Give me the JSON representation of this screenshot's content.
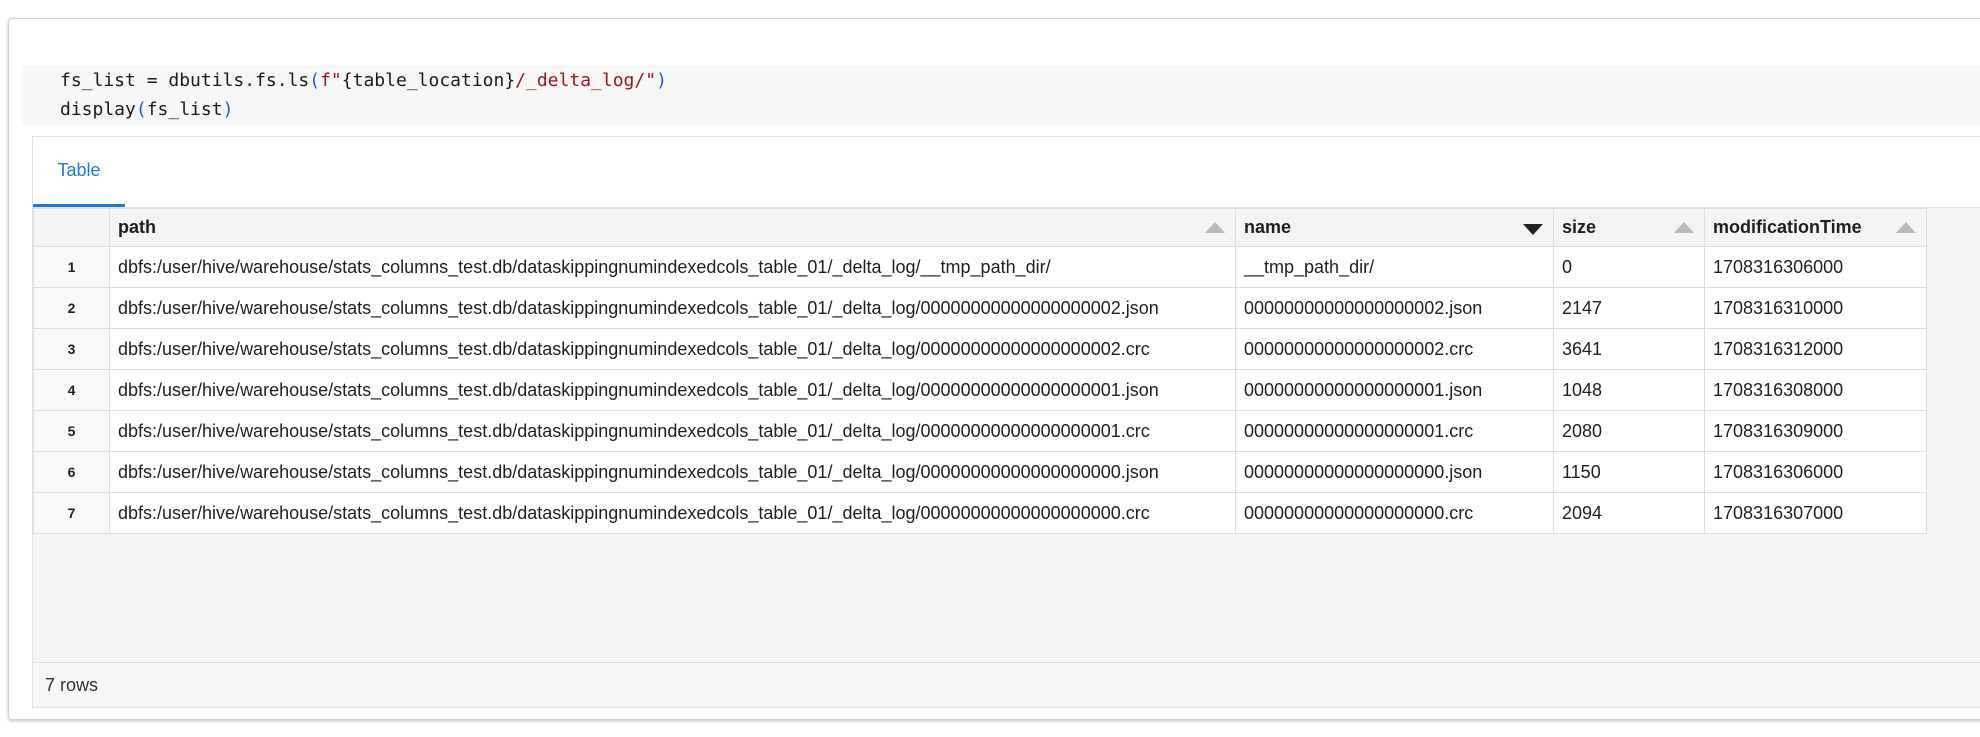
{
  "code": {
    "line1": {
      "a": "fs_list = dbutils.fs.ls",
      "b": "(",
      "c": "f\"",
      "d": "{table_location}",
      "e": "/_delta_log/\"",
      "f": ")"
    },
    "line2": {
      "a": "display",
      "b": "(",
      "c": "fs_list",
      "d": ")"
    }
  },
  "results": {
    "tab_label": "Table",
    "columns": [
      {
        "label": "path",
        "sort": "up"
      },
      {
        "label": "name",
        "sort": "down"
      },
      {
        "label": "size",
        "sort": "up"
      },
      {
        "label": "modificationTime",
        "sort": "up"
      }
    ],
    "rows": [
      {
        "num": "1",
        "path": "dbfs:/user/hive/warehouse/stats_columns_test.db/dataskippingnumindexedcols_table_01/_delta_log/__tmp_path_dir/",
        "name": "__tmp_path_dir/",
        "size": "0",
        "modificationTime": "1708316306000"
      },
      {
        "num": "2",
        "path": "dbfs:/user/hive/warehouse/stats_columns_test.db/dataskippingnumindexedcols_table_01/_delta_log/00000000000000000002.json",
        "name": "00000000000000000002.json",
        "size": "2147",
        "modificationTime": "1708316310000"
      },
      {
        "num": "3",
        "path": "dbfs:/user/hive/warehouse/stats_columns_test.db/dataskippingnumindexedcols_table_01/_delta_log/00000000000000000002.crc",
        "name": "00000000000000000002.crc",
        "size": "3641",
        "modificationTime": "1708316312000"
      },
      {
        "num": "4",
        "path": "dbfs:/user/hive/warehouse/stats_columns_test.db/dataskippingnumindexedcols_table_01/_delta_log/00000000000000000001.json",
        "name": "00000000000000000001.json",
        "size": "1048",
        "modificationTime": "1708316308000"
      },
      {
        "num": "5",
        "path": "dbfs:/user/hive/warehouse/stats_columns_test.db/dataskippingnumindexedcols_table_01/_delta_log/00000000000000000001.crc",
        "name": "00000000000000000001.crc",
        "size": "2080",
        "modificationTime": "1708316309000"
      },
      {
        "num": "6",
        "path": "dbfs:/user/hive/warehouse/stats_columns_test.db/dataskippingnumindexedcols_table_01/_delta_log/00000000000000000000.json",
        "name": "00000000000000000000.json",
        "size": "1150",
        "modificationTime": "1708316306000"
      },
      {
        "num": "7",
        "path": "dbfs:/user/hive/warehouse/stats_columns_test.db/dataskippingnumindexedcols_table_01/_delta_log/00000000000000000000.crc",
        "name": "00000000000000000000.crc",
        "size": "2094",
        "modificationTime": "1708316307000"
      }
    ],
    "footer": "7 rows"
  },
  "colors": {
    "accent": "#1c7cd6",
    "string": "#a31515",
    "paren": "#1f5fbf"
  }
}
